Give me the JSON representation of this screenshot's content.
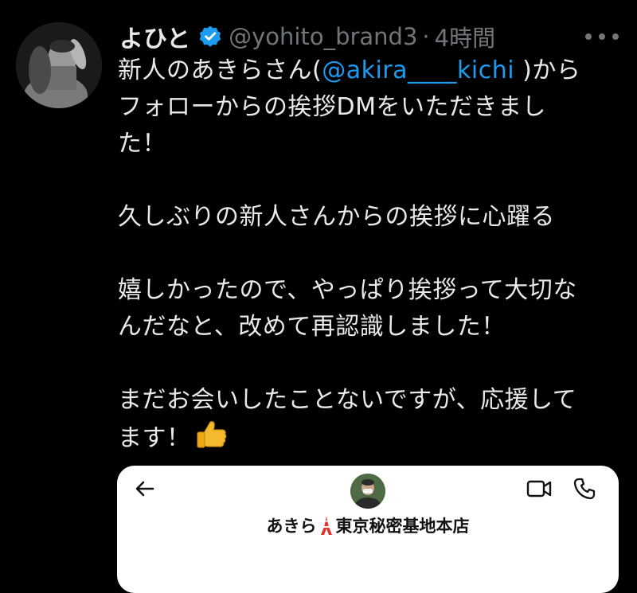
{
  "tweet": {
    "author": {
      "display_name": "よひと",
      "handle": "@yohito_brand3",
      "separator": "·",
      "time": "4時間",
      "verified": true
    },
    "lines": {
      "l1_before": "新人のあきらさん(",
      "l1_mention": "@akira____kichi",
      "l1_after": " )から",
      "l2": "フォローからの挨拶DMをいただきまし",
      "l3": "た！",
      "l4": "久しぶりの新人さんからの挨拶に心躍る",
      "l5": "嬉しかったので、やっぱり挨拶って大切な",
      "l6": "んだなと、改めて再認識しました！",
      "l7": "まだお会いしたことないですが、応援して",
      "l8": "ます！"
    },
    "emoji": "thumbs-up",
    "colors": {
      "text": "#e7e9ea",
      "secondary": "#71767b",
      "mention": "#1d9bf0",
      "verified": "#1d9bf0",
      "background": "#000000"
    }
  },
  "dm_screenshot": {
    "name_before": "あきら",
    "name_icon": "tokyo-tower",
    "name_after": "東京秘密基地本店",
    "icons": [
      "back-arrow-icon",
      "video-call-icon",
      "phone-icon"
    ]
  }
}
